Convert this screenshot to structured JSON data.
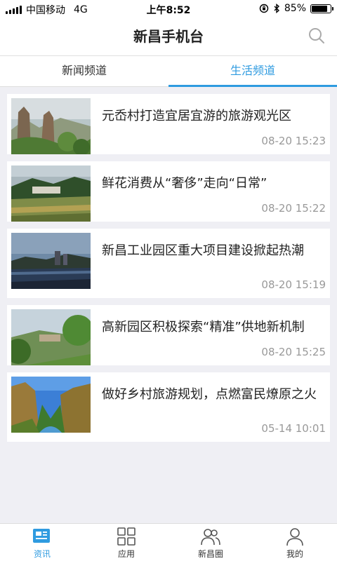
{
  "status_bar": {
    "carrier": "中国移动",
    "network": "4G",
    "time": "上午8:52",
    "battery_percent": "85%",
    "battery_level": 0.85
  },
  "header": {
    "title": "新昌手机台"
  },
  "tabs": [
    {
      "label": "新闻频道",
      "active": false
    },
    {
      "label": "生活频道",
      "active": true
    }
  ],
  "news": [
    {
      "title": "元岙村打造宜居宜游的旅游观光区",
      "time": "08-20 15:23"
    },
    {
      "title": "鲜花消费从“奢侈”走向“日常”",
      "time": "08-20 15:22"
    },
    {
      "title": "新昌工业园区重大项目建设掀起热潮",
      "time": "08-20 15:19"
    },
    {
      "title": "高新园区积极探索“精准”供地新机制",
      "time": "08-20 15:25"
    },
    {
      "title": "做好乡村旅游规划，点燃富民燎原之火",
      "time": "05-14 10:01"
    }
  ],
  "bottom_nav": [
    {
      "label": "资讯",
      "icon": "news-icon",
      "active": true
    },
    {
      "label": "应用",
      "icon": "apps-grid-icon",
      "active": false
    },
    {
      "label": "新昌圈",
      "icon": "community-icon",
      "active": false
    },
    {
      "label": "我的",
      "icon": "profile-icon",
      "active": false
    }
  ],
  "colors": {
    "accent": "#2f9be0",
    "background": "#efeff4",
    "time_text": "#999999"
  }
}
